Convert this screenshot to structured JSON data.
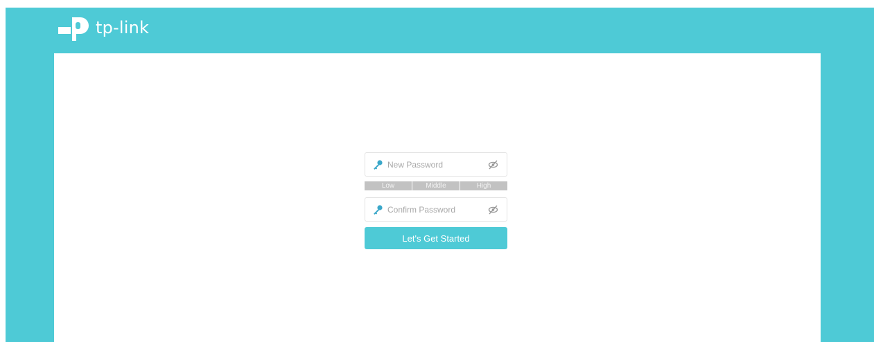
{
  "brand": {
    "logo_text": "tp-link",
    "accent_color": "#4ecad6"
  },
  "form": {
    "new_password": {
      "placeholder": "New Password",
      "value": "",
      "icon": "key-icon",
      "toggle_icon": "eye-hidden-icon"
    },
    "strength": {
      "levels": [
        "Low",
        "Middle",
        "High"
      ]
    },
    "confirm_password": {
      "placeholder": "Confirm Password",
      "value": "",
      "icon": "key-icon",
      "toggle_icon": "eye-hidden-icon"
    },
    "submit_label": "Let's Get Started"
  }
}
